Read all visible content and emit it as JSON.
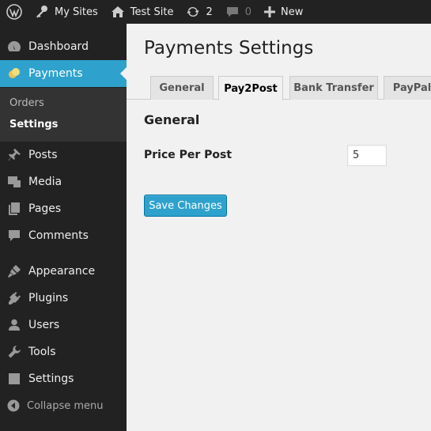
{
  "adminbar": {
    "my_sites": "My Sites",
    "site_name": "Test Site",
    "updates_count": "2",
    "comments_count": "0",
    "new_label": "New"
  },
  "sidebar": {
    "items": [
      {
        "label": "Dashboard",
        "icon": "dashboard-icon"
      },
      {
        "label": "Payments",
        "icon": "payments-icon",
        "current": true
      },
      {
        "label": "Posts",
        "icon": "pin-icon"
      },
      {
        "label": "Media",
        "icon": "media-icon"
      },
      {
        "label": "Pages",
        "icon": "pages-icon"
      },
      {
        "label": "Comments",
        "icon": "comment-icon"
      },
      {
        "label": "Appearance",
        "icon": "brush-icon"
      },
      {
        "label": "Plugins",
        "icon": "plug-icon"
      },
      {
        "label": "Users",
        "icon": "user-icon"
      },
      {
        "label": "Tools",
        "icon": "wrench-icon"
      },
      {
        "label": "Settings",
        "icon": "sliders-icon"
      }
    ],
    "submenu": [
      {
        "label": "Orders"
      },
      {
        "label": "Settings",
        "active": true
      }
    ],
    "collapse_label": "Collapse menu"
  },
  "main": {
    "title": "Payments Settings",
    "tabs": [
      {
        "label": "General"
      },
      {
        "label": "Pay2Post",
        "active": true
      },
      {
        "label": "Bank Transfer"
      },
      {
        "label": "PayPal"
      }
    ],
    "section_title": "General",
    "price_label": "Price Per Post",
    "price_value": "5",
    "save_label": "Save Changes"
  },
  "colors": {
    "accent": "#2ea2cc",
    "sidebar_bg": "#222222",
    "submenu_bg": "#333333",
    "page_bg": "#f1f1f1"
  }
}
